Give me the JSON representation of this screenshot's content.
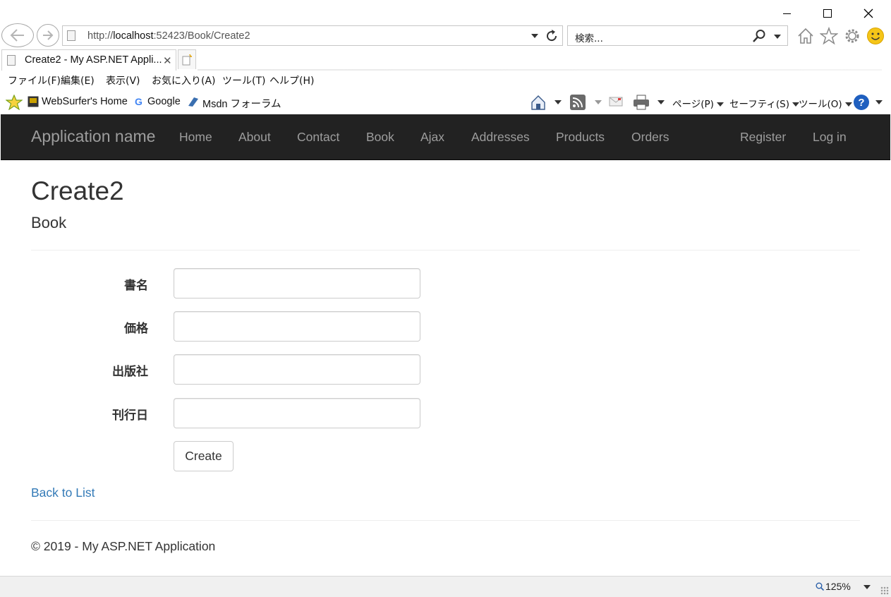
{
  "browser": {
    "address_url_prefix": "http://",
    "address_url_host": "localhost",
    "address_url_rest": ":52423/Book/Create2",
    "search_placeholder": "検索...",
    "tab_title": "Create2 - My ASP.NET Appli...",
    "tab_close": "✕",
    "menu": [
      "ファイル(F)",
      "編集(E)",
      "表示(V)",
      "お気に入り(A)",
      "ツール(T)",
      "ヘルプ(H)"
    ],
    "favorites": [
      "WebSurfer's Home",
      "Google",
      "Msdn フォーラム"
    ],
    "commands": {
      "page": "ページ(P)",
      "safety": "セーフティ(S)",
      "tools": "ツール(O)"
    },
    "zoom": "125%"
  },
  "navbar": {
    "brand": "Application name",
    "links": [
      "Home",
      "About",
      "Contact",
      "Book",
      "Ajax",
      "Addresses",
      "Products",
      "Orders"
    ],
    "right_links": [
      "Register",
      "Log in"
    ]
  },
  "page": {
    "title": "Create2",
    "subtitle": "Book",
    "fields": [
      {
        "label": "書名",
        "value": ""
      },
      {
        "label": "価格",
        "value": ""
      },
      {
        "label": "出版社",
        "value": ""
      },
      {
        "label": "刊行日",
        "value": ""
      }
    ],
    "submit_label": "Create",
    "back_link": "Back to List",
    "footer": "© 2019 - My ASP.NET Application"
  },
  "colors": {
    "navbar_bg": "#222222",
    "navbar_text": "#9d9d9d",
    "link": "#337ab7"
  }
}
